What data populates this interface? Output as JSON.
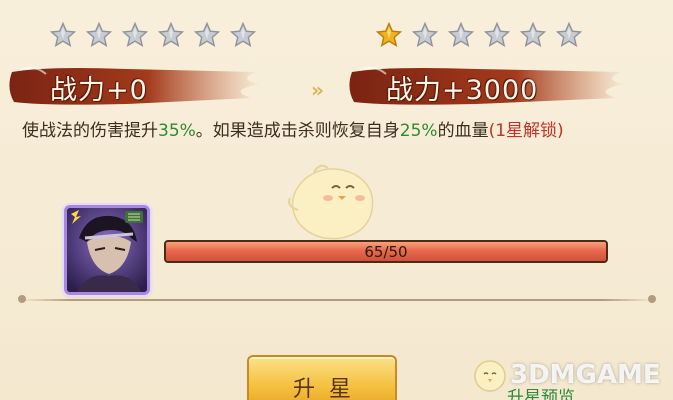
{
  "current": {
    "stars_filled": 0,
    "stars_total": 6,
    "power_label": "战力+0"
  },
  "next": {
    "stars_filled": 1,
    "stars_total": 6,
    "power_label": "战力+3000"
  },
  "arrow_glyph": "»",
  "description": {
    "part1": "使战法的伤害提升",
    "num1": "35%",
    "part2": "。如果造成击杀则恢复自身",
    "num2": "25%",
    "part3": "的血量",
    "lock_text": "(1星解锁)"
  },
  "hero": {
    "badge_icon": "lightning-icon"
  },
  "progress": {
    "text": "65/50",
    "fill_fraction": 1.0
  },
  "buttons": {
    "upgrade_label": "升星",
    "preview_label": "升星预览"
  },
  "watermark": {
    "text": "3DMGAME"
  },
  "colors": {
    "star_gold": "#f2b21c",
    "star_silver": "#c8ccd2",
    "progress_fill": "#e86a4e",
    "highlight_green": "#2f8a2e",
    "lock_red": "#c0332a",
    "button_gold": "#f4bf3b"
  }
}
